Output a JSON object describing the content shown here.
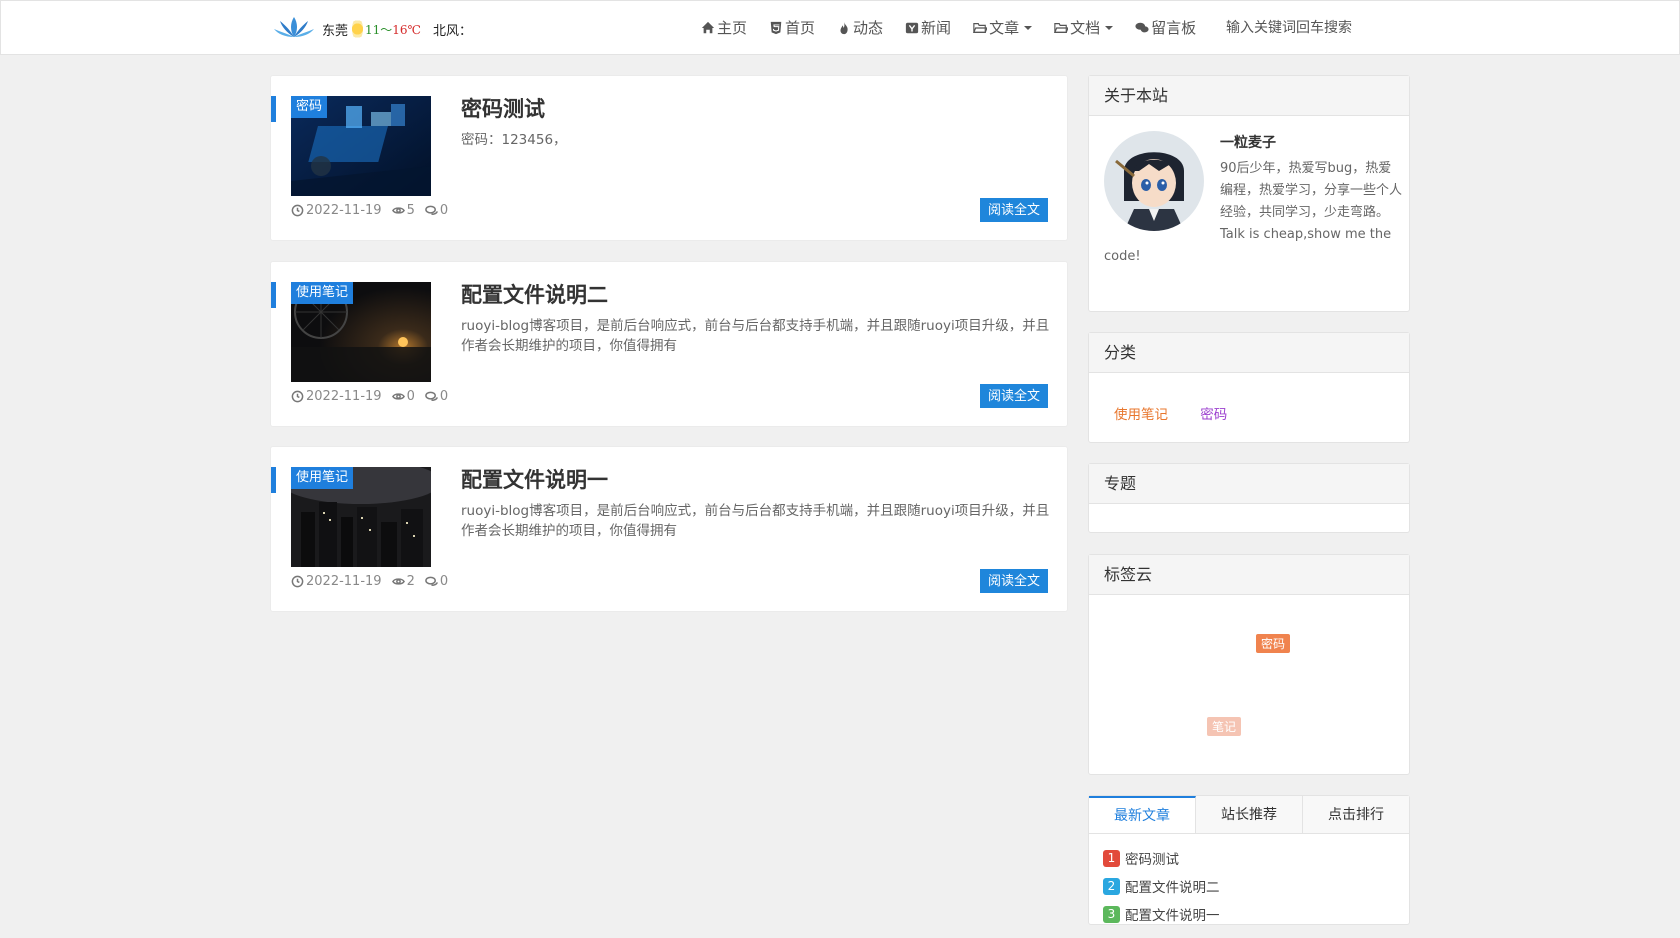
{
  "header": {
    "weather": {
      "city": "东莞",
      "temp_low": "11",
      "temp_sep": "～",
      "temp_high": "16℃",
      "wind": "北风："
    },
    "nav": [
      {
        "label": "主页",
        "icon": "home-icon"
      },
      {
        "label": "首页",
        "icon": "html5-icon"
      },
      {
        "label": "动态",
        "icon": "fire-icon"
      },
      {
        "label": "新闻",
        "icon": "news-icon"
      },
      {
        "label": "文章",
        "icon": "folder-icon",
        "dropdown": true
      },
      {
        "label": "文档",
        "icon": "folder-icon",
        "dropdown": true
      },
      {
        "label": "留言板",
        "icon": "comments-icon"
      }
    ],
    "search_placeholder": "输入关键词回车搜索"
  },
  "articles": [
    {
      "category": "密码",
      "title": "密码测试",
      "excerpt": "密码：123456，",
      "date": "2022-11-19",
      "views": "5",
      "comments": "0",
      "read_label": "阅读全文"
    },
    {
      "category": "使用笔记",
      "title": "配置文件说明二",
      "excerpt": "ruoyi-blog博客项目，是前后台响应式，前台与后台都支持手机端，并且跟随ruoyi项目升级，并且作者会长期维护的项目，你值得拥有",
      "date": "2022-11-19",
      "views": "0",
      "comments": "0",
      "read_label": "阅读全文"
    },
    {
      "category": "使用笔记",
      "title": "配置文件说明一",
      "excerpt": "ruoyi-blog博客项目，是前后台响应式，前台与后台都支持手机端，并且跟随ruoyi项目升级，并且作者会长期维护的项目，你值得拥有",
      "date": "2022-11-19",
      "views": "2",
      "comments": "0",
      "read_label": "阅读全文"
    }
  ],
  "sidebar": {
    "about": {
      "title": "关于本站",
      "name": "一粒麦子",
      "bio": "90后少年，热爱写bug，热爱编程，热爱学习，分享一些个人经验，共同学习，少走弯路。Talk is cheap,show me the code!"
    },
    "categories": {
      "title": "分类",
      "items": [
        {
          "label": "使用笔记",
          "color": "#e8772e"
        },
        {
          "label": "密码",
          "color": "#9b3fcf"
        }
      ]
    },
    "topics": {
      "title": "专题"
    },
    "tags": {
      "title": "标签云",
      "items": [
        {
          "label": "密码",
          "color": "#f0834e"
        },
        {
          "label": "笔记",
          "color": "#f5c4b3"
        }
      ]
    },
    "ranking": {
      "tabs": [
        "最新文章",
        "站长推荐",
        "点击排行"
      ],
      "items": [
        {
          "num": "1",
          "label": "密码测试",
          "color": "#e24a3b"
        },
        {
          "num": "2",
          "label": "配置文件说明二",
          "color": "#2aa7e0"
        },
        {
          "num": "3",
          "label": "配置文件说明一",
          "color": "#5cb85c"
        }
      ]
    }
  }
}
